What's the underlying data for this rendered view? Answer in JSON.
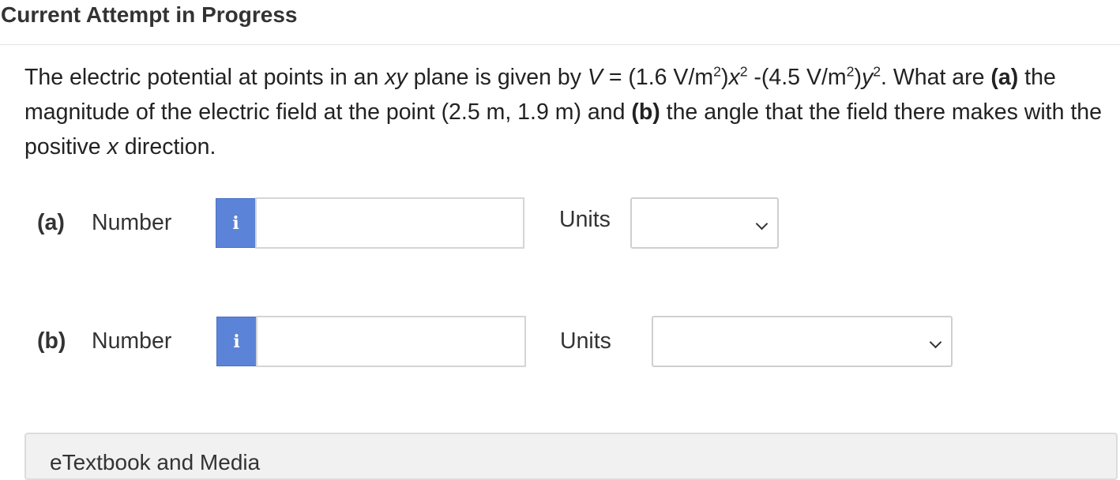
{
  "header": {
    "title": "Current Attempt in Progress"
  },
  "question": {
    "t1": "The electric potential at points in an ",
    "xy": "xy",
    "t2": " plane is given by ",
    "V": "V",
    "t3": " = (1.6 V/m",
    "exp1": "2",
    "t4": ")",
    "x1": "x",
    "exp2": "2",
    "t5": " -(4.5 V/m",
    "exp3": "2",
    "t6": ")",
    "y1": "y",
    "exp4": "2",
    "t7": ". What are ",
    "a": "(a)",
    "t8": " the magnitude of the electric field at the point (2.5 m, 1.9 m) and ",
    "b": "(b)",
    "t9": " the angle that the field there makes with the positive ",
    "x2": "x",
    "t10": " direction."
  },
  "part_a": {
    "label": "(a)",
    "number_label": "Number",
    "info_icon": "i",
    "number_value": "",
    "units_label": "Units",
    "units_selected": ""
  },
  "part_b": {
    "label": "(b)",
    "number_label": "Number",
    "info_icon": "i",
    "number_value": "",
    "units_label": "Units",
    "units_selected": ""
  },
  "etextbook": {
    "label": "eTextbook and Media"
  }
}
